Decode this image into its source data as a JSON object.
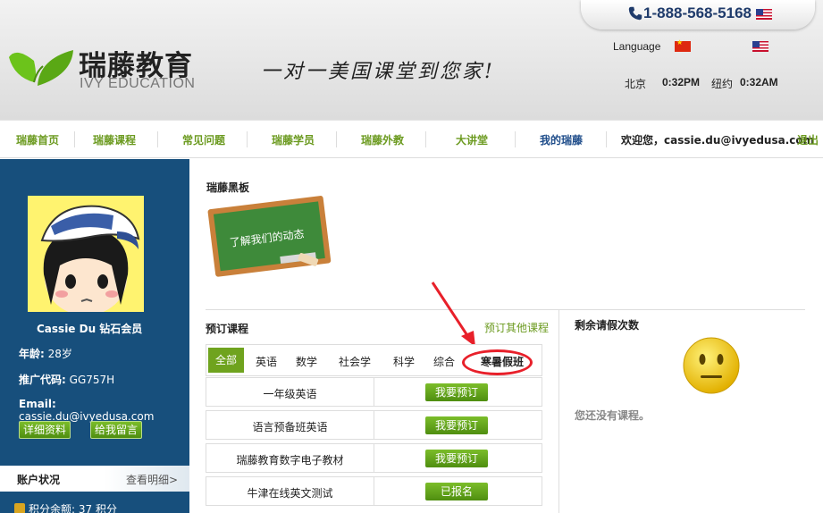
{
  "header": {
    "phone": "1-888-568-5168",
    "logo_cn": "瑞藤教育",
    "logo_en": "IVY EDUCATION",
    "slogan": "一对一美国课堂到您家!",
    "language_label": "Language",
    "beijing_label": "北京",
    "beijing_time": "0:32PM",
    "newyork_label": "纽约",
    "newyork_time": "0:32AM"
  },
  "nav": {
    "items": [
      "瑞藤首页",
      "瑞藤课程",
      "常见问题",
      "瑞藤学员",
      "瑞藤外教",
      "大讲堂",
      "我的瑞藤"
    ],
    "welcome": "欢迎您，cassie.du@ivyedusa.com",
    "logout": "退出"
  },
  "sidebar": {
    "name": "Cassie Du 钻石会员",
    "age_label": "年龄:",
    "age_value": "28岁",
    "code_label": "推广代码:",
    "code_value": "GG757H",
    "email_label": "Email:",
    "email_value": "cassie.du@ivyedusa.com",
    "details_button": "详细资料",
    "message_button": "给我留言",
    "account_title": "账户状况",
    "account_link": "查看明细>",
    "points": "积分余额: 37 积分"
  },
  "main": {
    "blackboard_title": "瑞藤黑板",
    "blackboard_text": "了解我们的动态",
    "booking_title": "预订课程",
    "other_courses_link": "预订其他课程",
    "tabs": [
      "全部",
      "英语",
      "数学",
      "社会学",
      "科学",
      "综合",
      "寒暑假班"
    ],
    "courses": [
      {
        "name": "一年级英语",
        "action": "我要预订"
      },
      {
        "name": "语言预备班英语",
        "action": "我要预订"
      },
      {
        "name": "瑞藤教育数字电子教材",
        "action": "我要预订"
      },
      {
        "name": "牛津在线英文测试",
        "action": "已报名"
      }
    ],
    "leave_title": "剩余请假次数",
    "leave_empty": "您还没有课程。"
  },
  "colors": {
    "brand_green": "#6fa31e",
    "sidebar_blue": "#174f7c",
    "highlight_red": "#e8202a",
    "nav_text": "#6b9a1f"
  },
  "icons": [
    "phone-icon",
    "us-flag-icon",
    "cn-flag-icon",
    "leaf-logo-icon",
    "avatar-image",
    "blackboard-image",
    "red-arrow-annotation",
    "neutral-face-icon",
    "coins-icon"
  ]
}
